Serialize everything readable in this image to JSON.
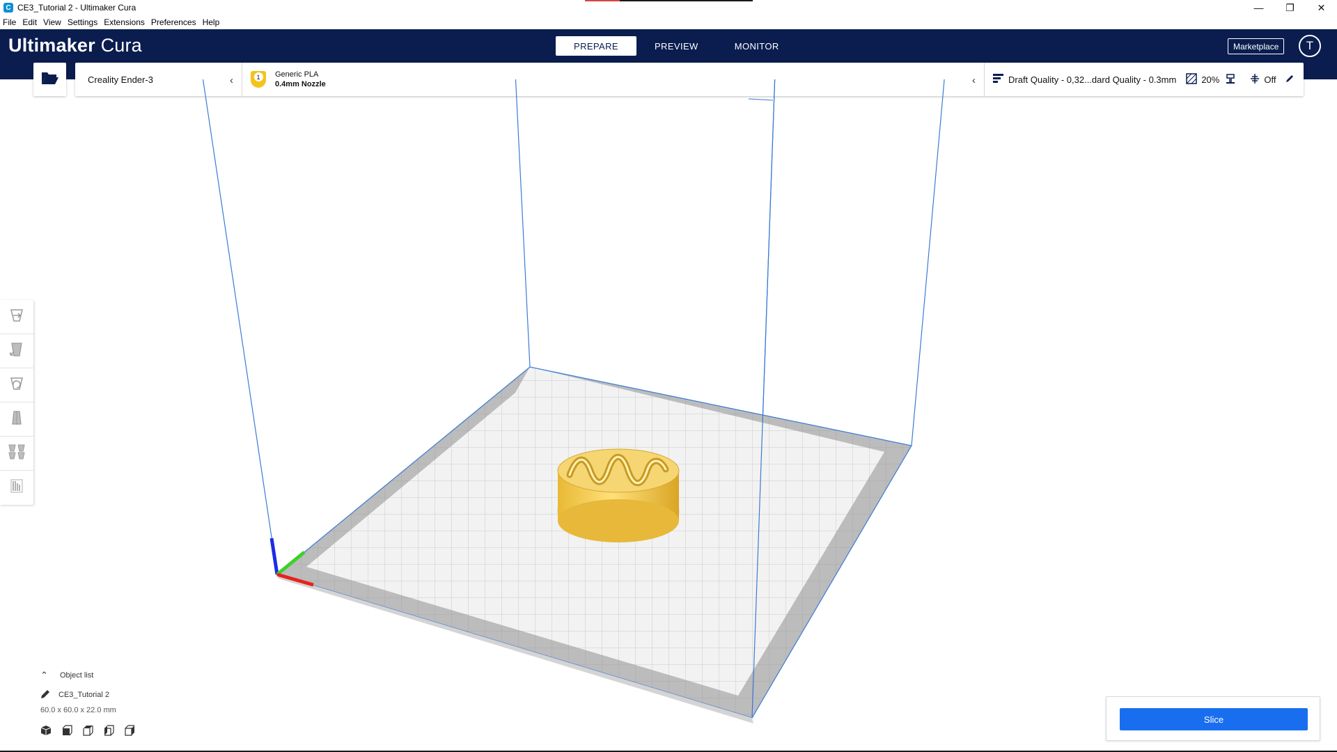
{
  "window": {
    "title": "CE3_Tutorial 2 - Ultimaker Cura",
    "app_icon_letter": "C",
    "controls": {
      "minimize": "—",
      "restore": "❐",
      "close": "✕"
    }
  },
  "menu": [
    "File",
    "Edit",
    "View",
    "Settings",
    "Extensions",
    "Preferences",
    "Help"
  ],
  "header": {
    "brand_bold": "Ultimaker",
    "brand_light": "Cura",
    "tabs": [
      {
        "label": "PREPARE",
        "active": true
      },
      {
        "label": "PREVIEW",
        "active": false
      },
      {
        "label": "MONITOR",
        "active": false
      }
    ],
    "marketplace": "Marketplace",
    "account_initial": "T"
  },
  "config": {
    "machine": "Creality Ender-3",
    "extruder_number": "1",
    "material": "Generic PLA",
    "nozzle": "0.4mm Nozzle",
    "profile": "Draft Quality - 0,32...dard Quality - 0.3mm",
    "infill": "20%",
    "adhesion": "Off"
  },
  "object_list": {
    "heading": "Object list",
    "item": "CE3_Tutorial 2",
    "dimensions": "60.0 x 60.0 x 22.0 mm"
  },
  "action": {
    "slice_label": "Slice",
    "button_color": "#196ef0"
  },
  "colors": {
    "header_bg": "#0a1d4e",
    "model": "#f3cf5a",
    "build_volume_lines": "#3a7bd5",
    "axis_x": "#e8221c",
    "axis_y": "#3ad12a",
    "axis_z": "#1c2be8"
  },
  "icons": {
    "open_file": "folder-open-icon",
    "toolbar": [
      "move-icon",
      "scale-icon",
      "rotate-icon",
      "mirror-icon",
      "per-model-settings-icon",
      "support-blocker-icon"
    ],
    "view_buttons": [
      "3d-view-icon",
      "front-view-icon",
      "top-view-icon",
      "left-view-icon",
      "right-view-icon"
    ]
  }
}
